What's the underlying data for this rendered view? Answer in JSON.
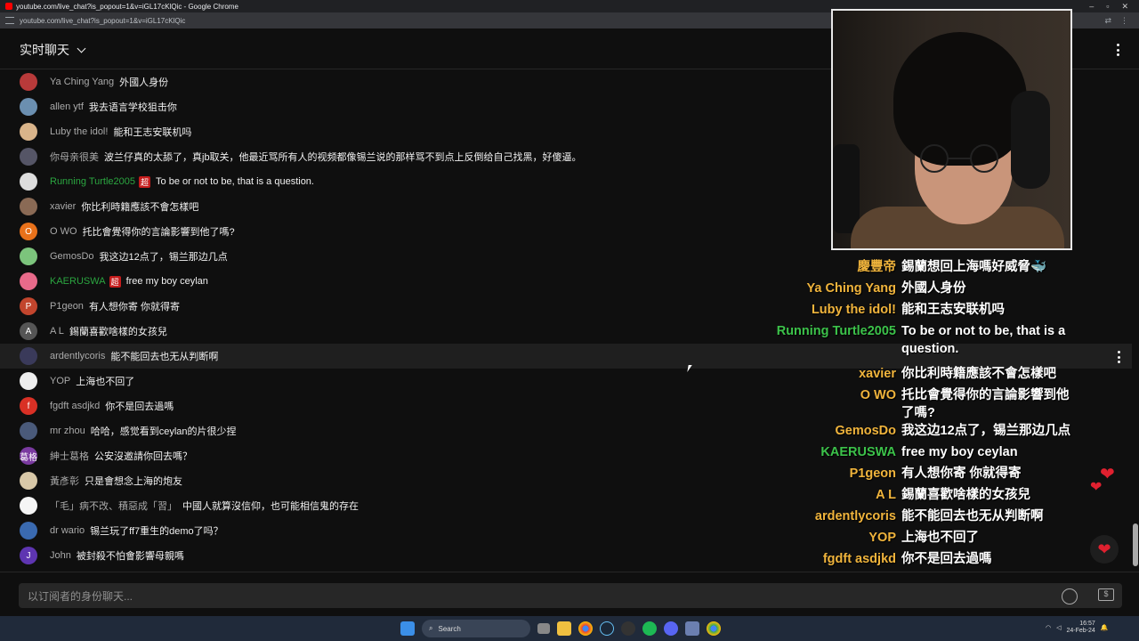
{
  "browser": {
    "title": "youtube.com/live_chat?is_popout=1&v=iGL17cKlQic - Google Chrome",
    "url": "youtube.com/live_chat?is_popout=1&v=iGL17cKlQic"
  },
  "header": {
    "title": "实时聊天"
  },
  "messages": [
    {
      "author": "Ya Ching Yang",
      "text": "外國人身份",
      "avatar_color": "#b83a3a",
      "initial": ""
    },
    {
      "author": "allen ytf",
      "text": "我去语言学校狙击你",
      "avatar_color": "#6b8fb0",
      "initial": ""
    },
    {
      "author": "Luby the idol!",
      "text": "能和王志安联机吗",
      "avatar_color": "#d9b48a",
      "initial": ""
    },
    {
      "author": "你母亲很美",
      "text": "波兰仔真的太舔了，真jb取关，他最近骂所有人的视频都像锡兰说的那样骂不到点上反倒给自己找黑，好傻逼。",
      "avatar_color": "#556",
      "initial": ""
    },
    {
      "author": "Running Turtle2005",
      "badge": "超",
      "member": true,
      "text": "To be or not to be, that is a question.",
      "avatar_color": "#ddd",
      "initial": ""
    },
    {
      "author": "xavier",
      "text": "你比利時籍應該不會怎樣吧",
      "avatar_color": "#8a6a55",
      "initial": ""
    },
    {
      "author": "O WO",
      "text": "托比會覺得你的言論影響到他了嗎?",
      "avatar_color": "#e8711a",
      "initial": "O"
    },
    {
      "author": "GemosDo",
      "text": "我这边12点了，锡兰那边几点",
      "avatar_color": "#7cc47c",
      "initial": ""
    },
    {
      "author": "KAERUSWA",
      "badge": "超",
      "member": true,
      "text": "free my boy ceylan",
      "avatar_color": "#e86a8a",
      "initial": ""
    },
    {
      "author": "P1geon",
      "text": "有人想你寄 你就得寄",
      "avatar_color": "#c2452d",
      "initial": "P"
    },
    {
      "author": "A L",
      "text": "錫蘭喜歡啥樣的女孩兒",
      "avatar_color": "#555",
      "initial": "A"
    },
    {
      "author": "ardentlycoris",
      "text": "能不能回去也无从判断啊",
      "avatar_color": "#3a3a5a",
      "initial": ""
    },
    {
      "author": "YOP",
      "text": "上海也不回了",
      "avatar_color": "#eee",
      "initial": ""
    },
    {
      "author": "fgdft asdjkd",
      "text": "你不是回去過嗎",
      "avatar_color": "#d93025",
      "initial": "f"
    },
    {
      "author": "mr zhou",
      "text": "哈哈，感觉看到ceylan的片很少捏",
      "avatar_color": "#4a5a7a",
      "initial": ""
    },
    {
      "author": "紳士葛格",
      "text": "公安沒邀請你回去嗎？",
      "avatar_color": "#7a3aa0",
      "initial": "葛格"
    },
    {
      "author": "黃彥彰",
      "text": "只是會想念上海的炮友",
      "avatar_color": "#d8c8a8",
      "initial": ""
    },
    {
      "author": "「毛」病不改、積惡成「習」",
      "text": "中國人就算沒信仰，也可能相信鬼的存在",
      "avatar_color": "#f5f5f5",
      "initial": ""
    },
    {
      "author": "dr wario",
      "text": "锡兰玩了ff7重生的demo了吗？",
      "avatar_color": "#3a6ab0",
      "initial": ""
    },
    {
      "author": "John",
      "text": "被封殺不怕會影響母親嗎",
      "avatar_color": "#5e35b1",
      "initial": "J"
    }
  ],
  "input": {
    "placeholder": "以订阅者的身份聊天..."
  },
  "overlay": [
    {
      "name": "慶豐帝",
      "text": "錫蘭想回上海嗎好威脅🐳"
    },
    {
      "name": "Ya Ching Yang",
      "text": "外國人身份"
    },
    {
      "name": "Luby the idol!",
      "text": "能和王志安联机吗"
    },
    {
      "name": "Running Turtle2005",
      "text": "To be or not to be, that is a question.",
      "member": true
    },
    {
      "name": "xavier",
      "text": "你比利時籍應該不會怎樣吧"
    },
    {
      "name": "O WO",
      "text": "托比會覺得你的言論影響到他了嗎?"
    },
    {
      "name": "GemosDo",
      "text": "我这边12点了，锡兰那边几点"
    },
    {
      "name": "KAERUSWA",
      "text": "free my boy ceylan",
      "member": true
    },
    {
      "name": "P1geon",
      "text": "有人想你寄 你就得寄"
    },
    {
      "name": "A L",
      "text": "錫蘭喜歡啥樣的女孩兒"
    },
    {
      "name": "ardentlycoris",
      "text": "能不能回去也无从判断啊"
    },
    {
      "name": "YOP",
      "text": "上海也不回了"
    },
    {
      "name": "fgdft asdjkd",
      "text": "你不是回去過嗎"
    },
    {
      "name": "mr zhou",
      "text": "哈哈，感觉看到ceylan的片很少捏"
    },
    {
      "name": "紳士葛格",
      "text": "公安沒邀請你回去嗎？"
    },
    {
      "name": "黃彥彰",
      "text": "只是會想念上海的炮友"
    }
  ],
  "taskbar": {
    "search_label": "Search",
    "time": "16:57",
    "date": "24-Feb-24"
  },
  "colors": {
    "member_name": "#2ba640",
    "overlay_name": "#f0b43c",
    "badge": "#c51c1c"
  }
}
